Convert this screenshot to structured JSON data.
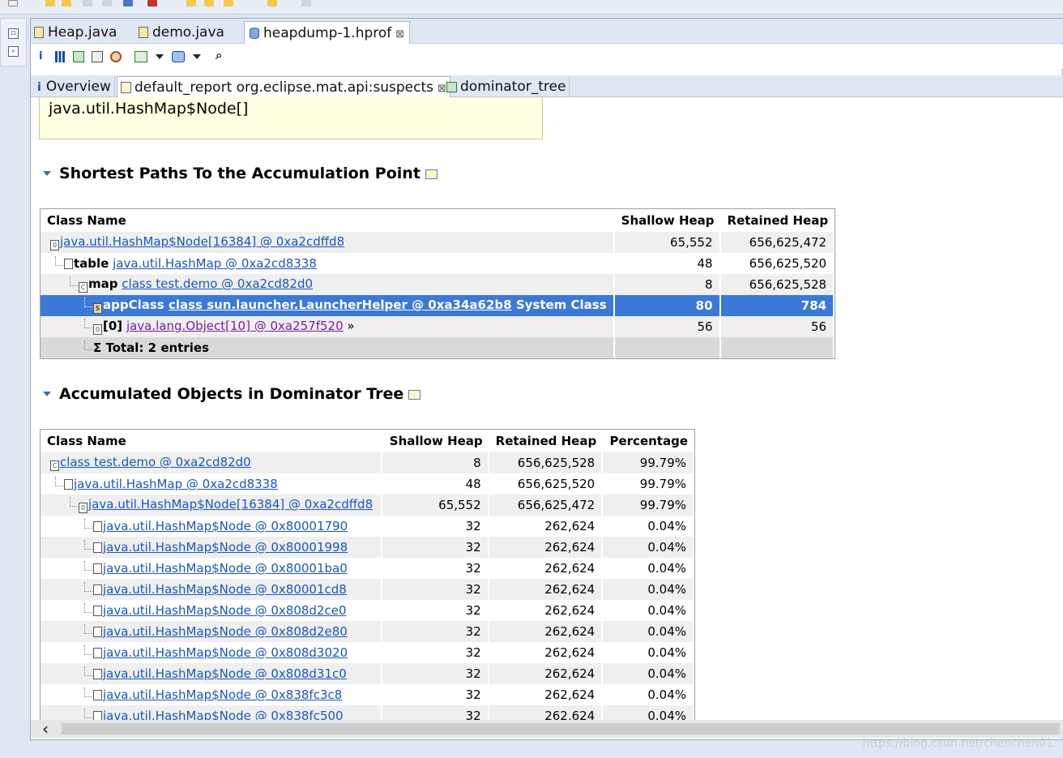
{
  "editor_tabs": [
    "Heap.java",
    "demo.java",
    "heapdump-1.hprof"
  ],
  "sub_tabs": [
    "Overview",
    "default_report  org.eclipse.mat.api:suspects",
    "dominator_tree"
  ],
  "toolbar_glyphs": {
    "info": "i",
    "search": "⌕"
  },
  "note_text": "java.util.HashMap$Node[]",
  "section1": {
    "title": "Shortest Paths To the Accumulation Point",
    "headers": [
      "Class Name",
      "Shallow Heap",
      "Retained Heap"
    ],
    "rows": [
      {
        "label": "",
        "link": "java.util.HashMap$Node[16384] @ 0xa2cdffd8",
        "suffix": "",
        "shallow": "65,552",
        "retained": "656,625,472"
      },
      {
        "label": "table",
        "link": "java.util.HashMap @ 0xa2cd8338",
        "suffix": "",
        "shallow": "48",
        "retained": "656,625,520"
      },
      {
        "label": "map",
        "link": "class test.demo @ 0xa2cd82d0",
        "suffix": "",
        "shallow": "8",
        "retained": "656,625,528"
      },
      {
        "label": "appClass",
        "link": "class sun.launcher.LauncherHelper @ 0xa34a62b8",
        "suffix": "System Class",
        "shallow": "80",
        "retained": "784"
      },
      {
        "label": "[0]",
        "link": "java.lang.Object[10] @ 0xa257f520",
        "suffix": "»",
        "shallow": "56",
        "retained": "56"
      }
    ],
    "total": "Σ Total: 2 entries"
  },
  "section2": {
    "title": "Accumulated Objects in Dominator Tree",
    "headers": [
      "Class Name",
      "Shallow Heap",
      "Retained Heap",
      "Percentage"
    ],
    "rows": [
      {
        "link": "class test.demo @ 0xa2cd82d0",
        "shallow": "8",
        "retained": "656,625,528",
        "pct": "99.79%"
      },
      {
        "link": "java.util.HashMap @ 0xa2cd8338",
        "shallow": "48",
        "retained": "656,625,520",
        "pct": "99.79%"
      },
      {
        "link": "java.util.HashMap$Node[16384] @ 0xa2cdffd8",
        "shallow": "65,552",
        "retained": "656,625,472",
        "pct": "99.79%"
      },
      {
        "link": "java.util.HashMap$Node @ 0x80001790",
        "shallow": "32",
        "retained": "262,624",
        "pct": "0.04%"
      },
      {
        "link": "java.util.HashMap$Node @ 0x80001998",
        "shallow": "32",
        "retained": "262,624",
        "pct": "0.04%"
      },
      {
        "link": "java.util.HashMap$Node @ 0x80001ba0",
        "shallow": "32",
        "retained": "262,624",
        "pct": "0.04%"
      },
      {
        "link": "java.util.HashMap$Node @ 0x80001cd8",
        "shallow": "32",
        "retained": "262,624",
        "pct": "0.04%"
      },
      {
        "link": "java.util.HashMap$Node @ 0x808d2ce0",
        "shallow": "32",
        "retained": "262,624",
        "pct": "0.04%"
      },
      {
        "link": "java.util.HashMap$Node @ 0x808d2e80",
        "shallow": "32",
        "retained": "262,624",
        "pct": "0.04%"
      },
      {
        "link": "java.util.HashMap$Node @ 0x808d3020",
        "shallow": "32",
        "retained": "262,624",
        "pct": "0.04%"
      },
      {
        "link": "java.util.HashMap$Node @ 0x808d31c0",
        "shallow": "32",
        "retained": "262,624",
        "pct": "0.04%"
      },
      {
        "link": "java.util.HashMap$Node @ 0x838fc3c8",
        "shallow": "32",
        "retained": "262,624",
        "pct": "0.04%"
      },
      {
        "link": "java.util.HashMap$Node @ 0x838fc500",
        "shallow": "32",
        "retained": "262,624",
        "pct": "0.04%"
      }
    ]
  },
  "scroll_arrow": "‹",
  "watermark": "https://blog.csdn.net/chenchen01"
}
